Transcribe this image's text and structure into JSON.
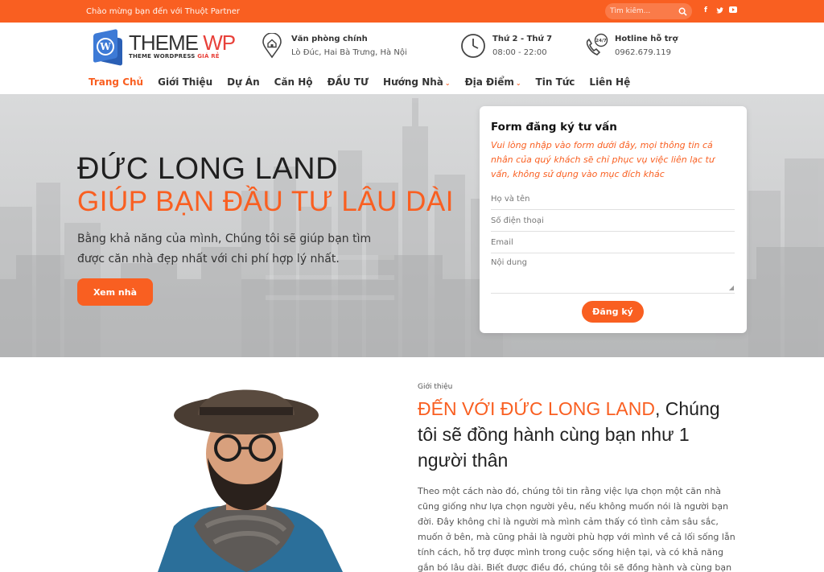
{
  "topbar": {
    "welcome": "Chào mừng bạn đến với Thuột Partner",
    "search_placeholder": "Tìm kiếm...",
    "social": [
      "f",
      "t",
      "y"
    ]
  },
  "logo": {
    "brand_theme": "THEME",
    "brand_wp": "WP",
    "tagline": "THEME WORDPRESS",
    "tagline_accent": "GIÁ RẺ"
  },
  "header": {
    "office_title": "Văn phòng chính",
    "office_address": "Lò Đúc, Hai Bà Trưng, Hà Nội",
    "hours_title": "Thứ 2 - Thứ 7",
    "hours_value": "08:00 - 22:00",
    "hotline_title": "Hotline hỗ trợ",
    "hotline_value": "0962.679.119",
    "hotline_badge": "24/7"
  },
  "nav": {
    "items": [
      "Trang Chủ",
      "Giới Thiệu",
      "Dự Án",
      "Căn Hộ",
      "ĐẦU TƯ",
      "Hướng Nhà",
      "Địa Điểm",
      "Tin Tức",
      "Liên Hệ"
    ]
  },
  "hero": {
    "title_line1": "ĐỨC LONG LAND",
    "title_line2": "GIÚP BẠN ĐẦU TƯ LÂU DÀI",
    "description": "Bằng khả năng của mình, Chúng tôi sẽ giúp bạn tìm được căn nhà đẹp nhất với chi phí hợp lý nhất.",
    "button": "Xem nhà"
  },
  "form": {
    "title": "Form đăng ký tư vấn",
    "description": "Vui lòng nhập vào form dưới đây, mọi thông tin cá nhân của quý khách sẽ chỉ phục vụ việc liên lạc tư vấn, không sử dụng vào mục đích khác",
    "name_placeholder": "Họ và tên",
    "phone_placeholder": "Số điện thoại",
    "email_placeholder": "Email",
    "content_placeholder": "Nội dung",
    "submit": "Đăng ký"
  },
  "intro": {
    "kicker": "Giới thiệu",
    "headline_accent": "ĐẾN VỚI ĐỨC LONG LAND",
    "headline_rest": ", Chúng tôi sẽ đồng hành cùng bạn như 1 người thân",
    "body": "Theo một cách nào đó, chúng tôi tin rằng việc lựa chọn một căn nhà cũng giống như lựa chọn người yêu, nếu không muốn nói là người bạn đời. Đây không chỉ là người mà mình cảm thấy có tình cảm sâu sắc, muốn ở bên, mà cũng phải là người phù hợp với mình về cả lối sống lẫn tính cách, hỗ trợ được mình trong cuộc sống hiện tại, và có khả năng gắn bó lâu dài. Biết được điều đó, chúng tôi sẽ đồng hành và cùng bạn đi tìm căn nhà, tìm nơi"
  },
  "colors": {
    "accent": "#f95f21",
    "text": "#333333"
  }
}
